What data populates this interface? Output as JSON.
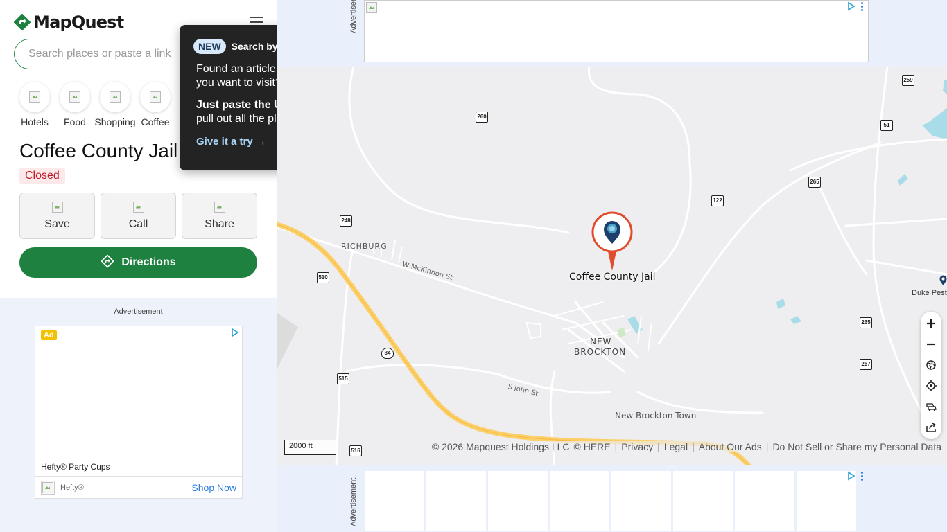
{
  "app": {
    "brand_name": "MapQuest",
    "brand_color": "#1f8140"
  },
  "search": {
    "placeholder": "Search places or paste a link"
  },
  "categories": [
    {
      "label": "Hotels",
      "icon": "hotel-icon"
    },
    {
      "label": "Food",
      "icon": "food-icon"
    },
    {
      "label": "Shopping",
      "icon": "shopping-icon"
    },
    {
      "label": "Coffee",
      "icon": "coffee-icon"
    }
  ],
  "place": {
    "title": "Coffee County Jail",
    "status": "Closed",
    "status_color": "#c01828"
  },
  "actions": {
    "save_label": "Save",
    "call_label": "Call",
    "share_label": "Share",
    "directions_label": "Directions"
  },
  "left_ad": {
    "label": "Advertisement",
    "badge": "Ad",
    "headline": "Hefty® Party Cups",
    "brand": "Hefty®",
    "cta": "Shop Now"
  },
  "popup": {
    "badge": "NEW",
    "heading": "Search by link",
    "line1": "Found an article with places you want to visit?",
    "line2_bold": "Just paste the URL",
    "line2_rest": " — we'll pull out all the places for you.",
    "cta": "Give it a try →"
  },
  "top_ad": {
    "label": "Advertisement"
  },
  "bottom_ad": {
    "label": "Advertisement"
  },
  "map": {
    "marker_label": "Coffee County Jail",
    "poi_label": "Duke Pest",
    "places": [
      "RICHBURG",
      "NEW",
      "BROCKTON",
      "New Brockton Town"
    ],
    "streets": [
      "W McKinnon St",
      "S John St"
    ],
    "route_shields": [
      "259",
      "260",
      "51",
      "265",
      "122",
      "248",
      "510",
      "84",
      "515",
      "516",
      "265",
      "267"
    ],
    "scale_label": "2000 ft",
    "footer": {
      "copyright": "© 2026 Mapquest Holdings LLC",
      "here": "© HERE",
      "privacy": "Privacy",
      "legal": "Legal",
      "about_ads": "About Our Ads",
      "do_not_sell": "Do Not Sell or Share my Personal Data"
    },
    "controls": [
      "zoom-in-icon",
      "zoom-out-icon",
      "globe-icon",
      "locate-icon",
      "traffic-icon",
      "share-icon"
    ]
  }
}
